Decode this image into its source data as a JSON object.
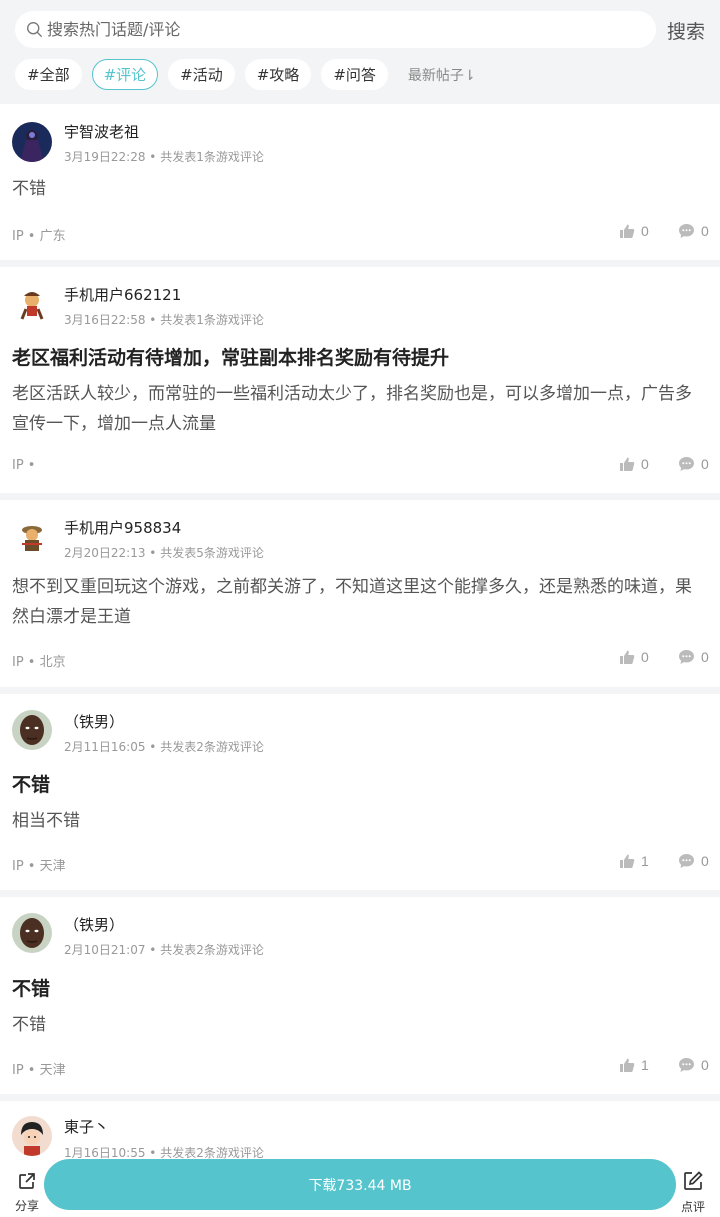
{
  "search": {
    "placeholder": "搜索热门话题/评论",
    "button": "搜索"
  },
  "tags": [
    "#全部",
    "#评论",
    "#活动",
    "#攻略",
    "#问答"
  ],
  "active_tag": "#评论",
  "sort_label": "最新帖子⇂",
  "posts": [
    {
      "user": "宇智波老祖",
      "meta": "3月19日22:28 • 共发表1条游戏评论",
      "title": "",
      "body": "不错",
      "ip": "IP • 广东",
      "likes": "0",
      "comments": "0"
    },
    {
      "user": "手机用户662121",
      "meta": "3月16日22:58 • 共发表1条游戏评论",
      "title": "老区福利活动有待增加，常驻副本排名奖励有待提升",
      "body": "老区活跃人较少，而常驻的一些福利活动太少了，排名奖励也是，可以多增加一点，广告多宣传一下，增加一点人流量",
      "ip": "IP •",
      "likes": "0",
      "comments": "0"
    },
    {
      "user": "手机用户958834",
      "meta": "2月20日22:13 • 共发表5条游戏评论",
      "title": "",
      "body": "想不到又重回玩这个游戏，之前都关游了，不知道这里这个能撑多久，还是熟悉的味道，果然白漂才是王道",
      "ip": "IP • 北京",
      "likes": "0",
      "comments": "0"
    },
    {
      "user": "（铁男）",
      "meta": "2月11日16:05 • 共发表2条游戏评论",
      "title": "不错",
      "body": "相当不错",
      "ip": "IP • 天津",
      "likes": "1",
      "comments": "0"
    },
    {
      "user": "（铁男）",
      "meta": "2月10日21:07 • 共发表2条游戏评论",
      "title": "不错",
      "body": "不错",
      "ip": "IP • 天津",
      "likes": "1",
      "comments": "0"
    },
    {
      "user": "東子丶",
      "meta": "1月16日10:55 • 共发表2条游戏评论",
      "title": "",
      "body": "",
      "ip": "",
      "likes": "",
      "comments": ""
    }
  ],
  "bottom": {
    "share": "分享",
    "download": "下载733.44 MB",
    "review": "点评"
  },
  "colors": {
    "accent": "#55c4cc",
    "background": "#f3f4f6"
  },
  "icons": [
    "search-icon",
    "thumbs-up-icon",
    "comment-icon",
    "share-icon",
    "edit-icon"
  ]
}
